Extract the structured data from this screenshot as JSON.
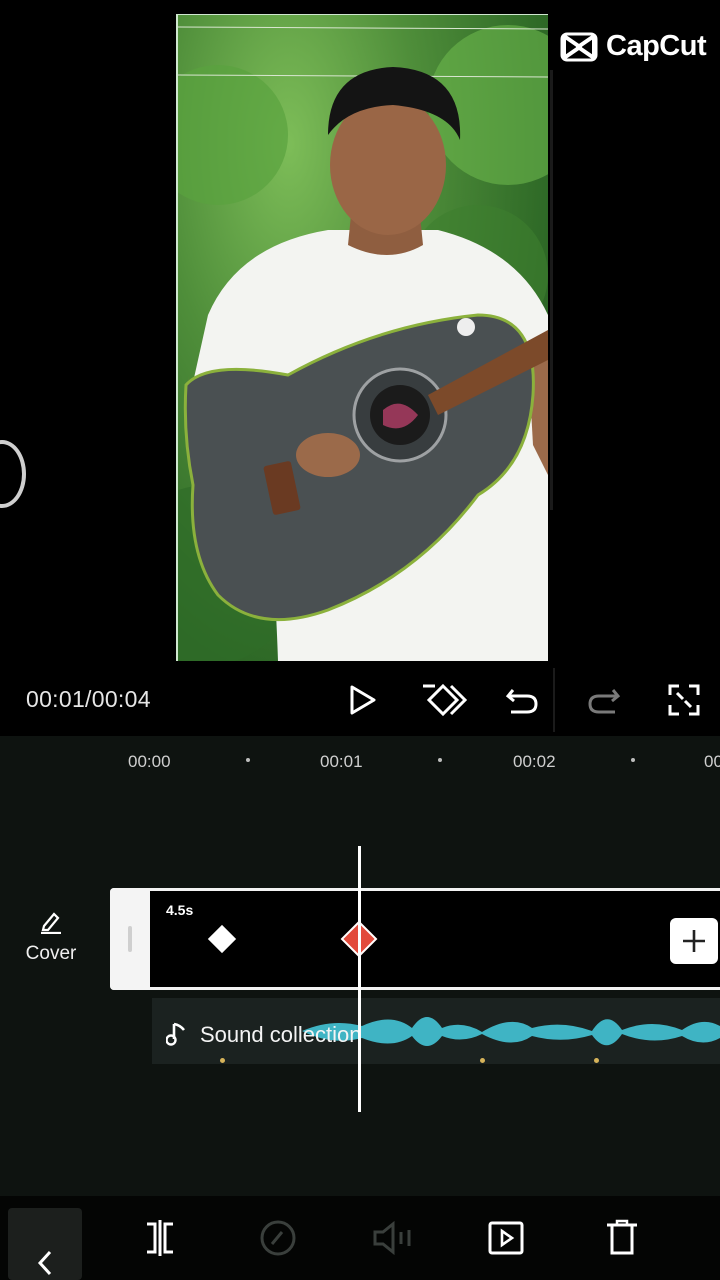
{
  "app": {
    "logo_text": "CapCut"
  },
  "player": {
    "timecode": "00:01/00:04",
    "buttons": [
      "play-icon",
      "keyframe-icon",
      "undo-icon",
      "redo-icon",
      "fullscreen-icon"
    ]
  },
  "timeline": {
    "ruler": [
      "00:00",
      "00:01",
      "00:02",
      "00"
    ],
    "cover_label": "Cover",
    "clip_duration": "4.5s",
    "audio_label": "Sound collection"
  },
  "toolbar": {
    "items": [
      "back-icon",
      "split-icon",
      "speed-icon",
      "volume-icon",
      "animation-icon",
      "delete-icon"
    ]
  },
  "colors": {
    "accent_keyframe": "#e24a3b",
    "waveform": "#3fb4c4",
    "background": "#000000"
  }
}
